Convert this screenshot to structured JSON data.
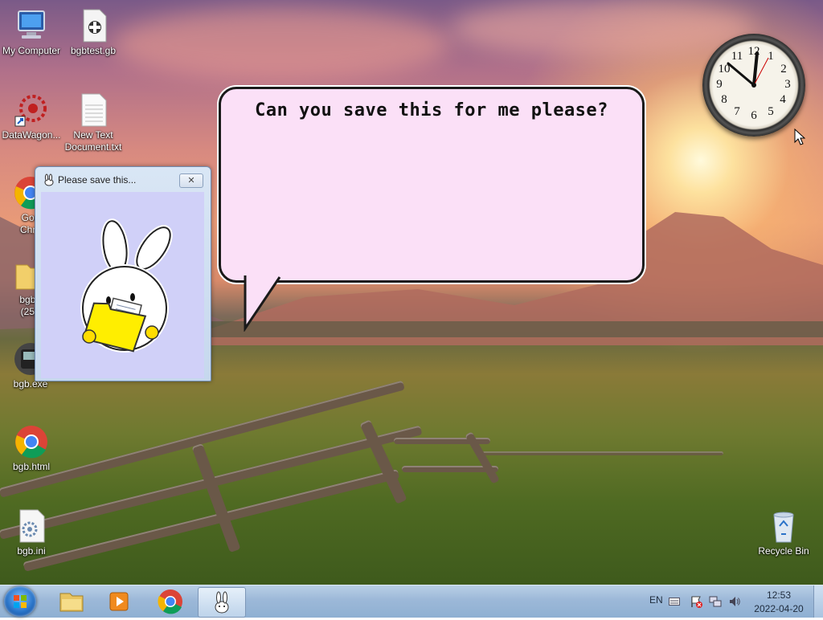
{
  "desktop": {
    "icons": [
      {
        "id": "my-computer",
        "label": "My Computer"
      },
      {
        "id": "bgbtest",
        "label": "bgbtest.gb"
      },
      {
        "id": "datawagon",
        "label": "DataWagon..."
      },
      {
        "id": "new-text",
        "label": "New Text Document.txt"
      },
      {
        "id": "chrome",
        "label": "Goo\nChro"
      },
      {
        "id": "bgb-folder",
        "label": "bgb -\n(25)."
      },
      {
        "id": "bgb-exe",
        "label": "bgb.exe"
      },
      {
        "id": "bgb-html",
        "label": "bgb.html"
      },
      {
        "id": "bgb-ini",
        "label": "bgb.ini"
      },
      {
        "id": "recycle-bin",
        "label": "Recycle Bin"
      }
    ]
  },
  "clock_gadget": {
    "numbers": [
      "12",
      "1",
      "2",
      "3",
      "4",
      "5",
      "6",
      "7",
      "8",
      "9",
      "10",
      "11"
    ],
    "time": "12:53"
  },
  "speech_bubble": {
    "text": "Can you save this for me please?",
    "fill_color": "#fbe0f7"
  },
  "window": {
    "title": "Please save this...",
    "close_label": "✕",
    "client_color": "#d0d0f8"
  },
  "taskbar": {
    "language": "EN",
    "time": "12:53",
    "date": "2022-04-20",
    "pinned": [
      "Windows Explorer",
      "Windows Media Player",
      "Google Chrome",
      "bgb"
    ]
  }
}
